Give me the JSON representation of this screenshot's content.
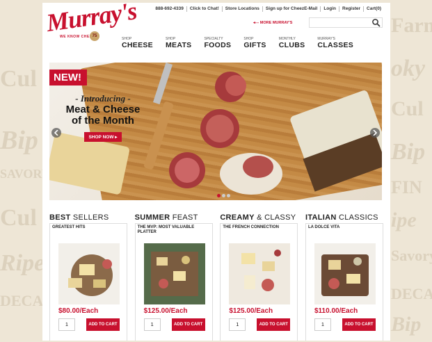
{
  "background_words": [
    "Cul",
    "Bip",
    "SAVORY",
    "Cul",
    "Ripe",
    "DECA",
    "Farm",
    "oky",
    "Cul",
    "Bip",
    "FIN",
    "ipe",
    "Savory",
    "DECA",
    "Bip"
  ],
  "logo": {
    "wordmark": "Murray's",
    "tagline": "WE KNOW CHEESE",
    "badge_text": "75"
  },
  "utility_links": [
    "888-692-4339",
    "Click to Chat!",
    "Store Locations",
    "Sign up for CheezE-Mail",
    "Login",
    "Register",
    "Cart(0)"
  ],
  "more_murrays": "MORE MURRAY'S",
  "search": {
    "placeholder": ""
  },
  "nav": [
    {
      "small": "Shop",
      "big": "CHEESE"
    },
    {
      "small": "Shop",
      "big": "MEATS"
    },
    {
      "small": "Specialty",
      "big": "FOODS"
    },
    {
      "small": "Shop",
      "big": "GIFTS"
    },
    {
      "small": "Monthly",
      "big": "CLUBS"
    },
    {
      "small": "Murray's",
      "big": "CLASSES"
    }
  ],
  "hero": {
    "badge": "NEW!",
    "intro": "- Introducing -",
    "title_line1": "Meat & Cheese",
    "title_line2": "of the Month",
    "cta": "SHOP NOW ▸"
  },
  "products": [
    {
      "heading_bold": "BEST",
      "heading_light": "SELLERS",
      "subtitle": "GREATEST HITS",
      "price": "$80.00/Each",
      "qty": "1",
      "button": "ADD TO CART",
      "plate_color": "#8b6a4a"
    },
    {
      "heading_bold": "SUMMER",
      "heading_light": "FEAST",
      "subtitle": "THE MVP: MOST VALUABLE PLATTER",
      "price": "$125.00/Each",
      "qty": "1",
      "button": "ADD TO CART",
      "plate_color": "#556b4a"
    },
    {
      "heading_bold": "CREAMY",
      "heading_light": "& CLASSY",
      "subtitle": "THE FRENCH CONNECTION",
      "price": "$125.00/Each",
      "qty": "1",
      "button": "ADD TO CART",
      "plate_color": "#efe9df"
    },
    {
      "heading_bold": "ITALIAN",
      "heading_light": "CLASSICS",
      "subtitle": "LA DOLCE VITA",
      "price": "$110.00/Each",
      "qty": "1",
      "button": "ADD TO CART",
      "plate_color": "#6b4a35"
    }
  ],
  "colors": {
    "brand_red": "#c8102e",
    "background": "#eee6d6"
  }
}
